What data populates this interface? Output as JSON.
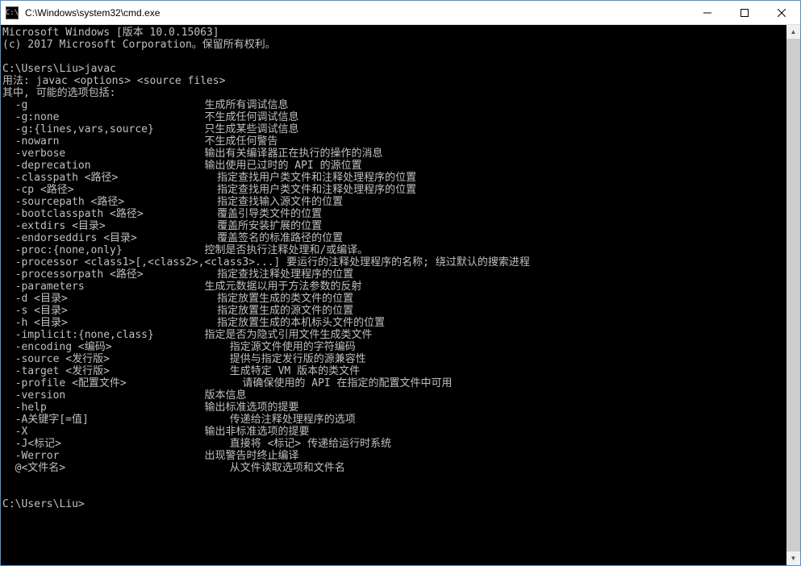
{
  "titlebar": {
    "icon_label": "C:\\",
    "title": "C:\\Windows\\system32\\cmd.exe"
  },
  "header_lines": [
    "Microsoft Windows [版本 10.0.15063]",
    "(c) 2017 Microsoft Corporation。保留所有权利。",
    ""
  ],
  "prompt1": "C:\\Users\\Liu>javac",
  "usage": "用法: javac <options> <source files>",
  "options_intro": "其中, 可能的选项包括:",
  "options": [
    {
      "flag": "-g",
      "desc": "生成所有调试信息"
    },
    {
      "flag": "-g:none",
      "desc": "不生成任何调试信息"
    },
    {
      "flag": "-g:{lines,vars,source}",
      "desc": "只生成某些调试信息"
    },
    {
      "flag": "-nowarn",
      "desc": "不生成任何警告"
    },
    {
      "flag": "-verbose",
      "desc": "输出有关编译器正在执行的操作的消息"
    },
    {
      "flag": "-deprecation",
      "desc": "输出使用已过时的 API 的源位置"
    },
    {
      "flag": "-classpath <路径>",
      "desc": "  指定查找用户类文件和注释处理程序的位置"
    },
    {
      "flag": "-cp <路径>",
      "desc": "  指定查找用户类文件和注释处理程序的位置"
    },
    {
      "flag": "-sourcepath <路径>",
      "desc": "  指定查找输入源文件的位置"
    },
    {
      "flag": "-bootclasspath <路径>",
      "desc": "  覆盖引导类文件的位置"
    },
    {
      "flag": "-extdirs <目录>",
      "desc": "  覆盖所安装扩展的位置"
    },
    {
      "flag": "-endorseddirs <目录>",
      "desc": "  覆盖签名的标准路径的位置"
    },
    {
      "flag": "-proc:{none,only}",
      "desc": "控制是否执行注释处理和/或编译。"
    },
    {
      "flag": "-processor <class1>[,<class2>,<class3>...] 要运行的注释处理程序的名称; 绕过默认的搜索进程",
      "desc": ""
    },
    {
      "flag": "-processorpath <路径>",
      "desc": "  指定查找注释处理程序的位置"
    },
    {
      "flag": "-parameters",
      "desc": "生成元数据以用于方法参数的反射"
    },
    {
      "flag": "-d <目录>",
      "desc": "  指定放置生成的类文件的位置"
    },
    {
      "flag": "-s <目录>",
      "desc": "  指定放置生成的源文件的位置"
    },
    {
      "flag": "-h <目录>",
      "desc": "  指定放置生成的本机标头文件的位置"
    },
    {
      "flag": "-implicit:{none,class}",
      "desc": "指定是否为隐式引用文件生成类文件"
    },
    {
      "flag": "-encoding <编码>",
      "desc": "    指定源文件使用的字符编码"
    },
    {
      "flag": "-source <发行版>",
      "desc": "    提供与指定发行版的源兼容性"
    },
    {
      "flag": "-target <发行版>",
      "desc": "    生成特定 VM 版本的类文件"
    },
    {
      "flag": "-profile <配置文件>",
      "desc": "      请确保使用的 API 在指定的配置文件中可用"
    },
    {
      "flag": "-version",
      "desc": "版本信息"
    },
    {
      "flag": "-help",
      "desc": "输出标准选项的提要"
    },
    {
      "flag": "-A关键字[=值]",
      "desc": "    传递给注释处理程序的选项"
    },
    {
      "flag": "-X",
      "desc": "输出非标准选项的提要"
    },
    {
      "flag": "-J<标记>",
      "desc": "    直接将 <标记> 传递给运行时系统"
    },
    {
      "flag": "-Werror",
      "desc": "出现警告时终止编译"
    },
    {
      "flag": "@<文件名>",
      "desc": "    从文件读取选项和文件名"
    }
  ],
  "footer_lines": [
    "",
    "",
    "C:\\Users\\Liu>"
  ]
}
